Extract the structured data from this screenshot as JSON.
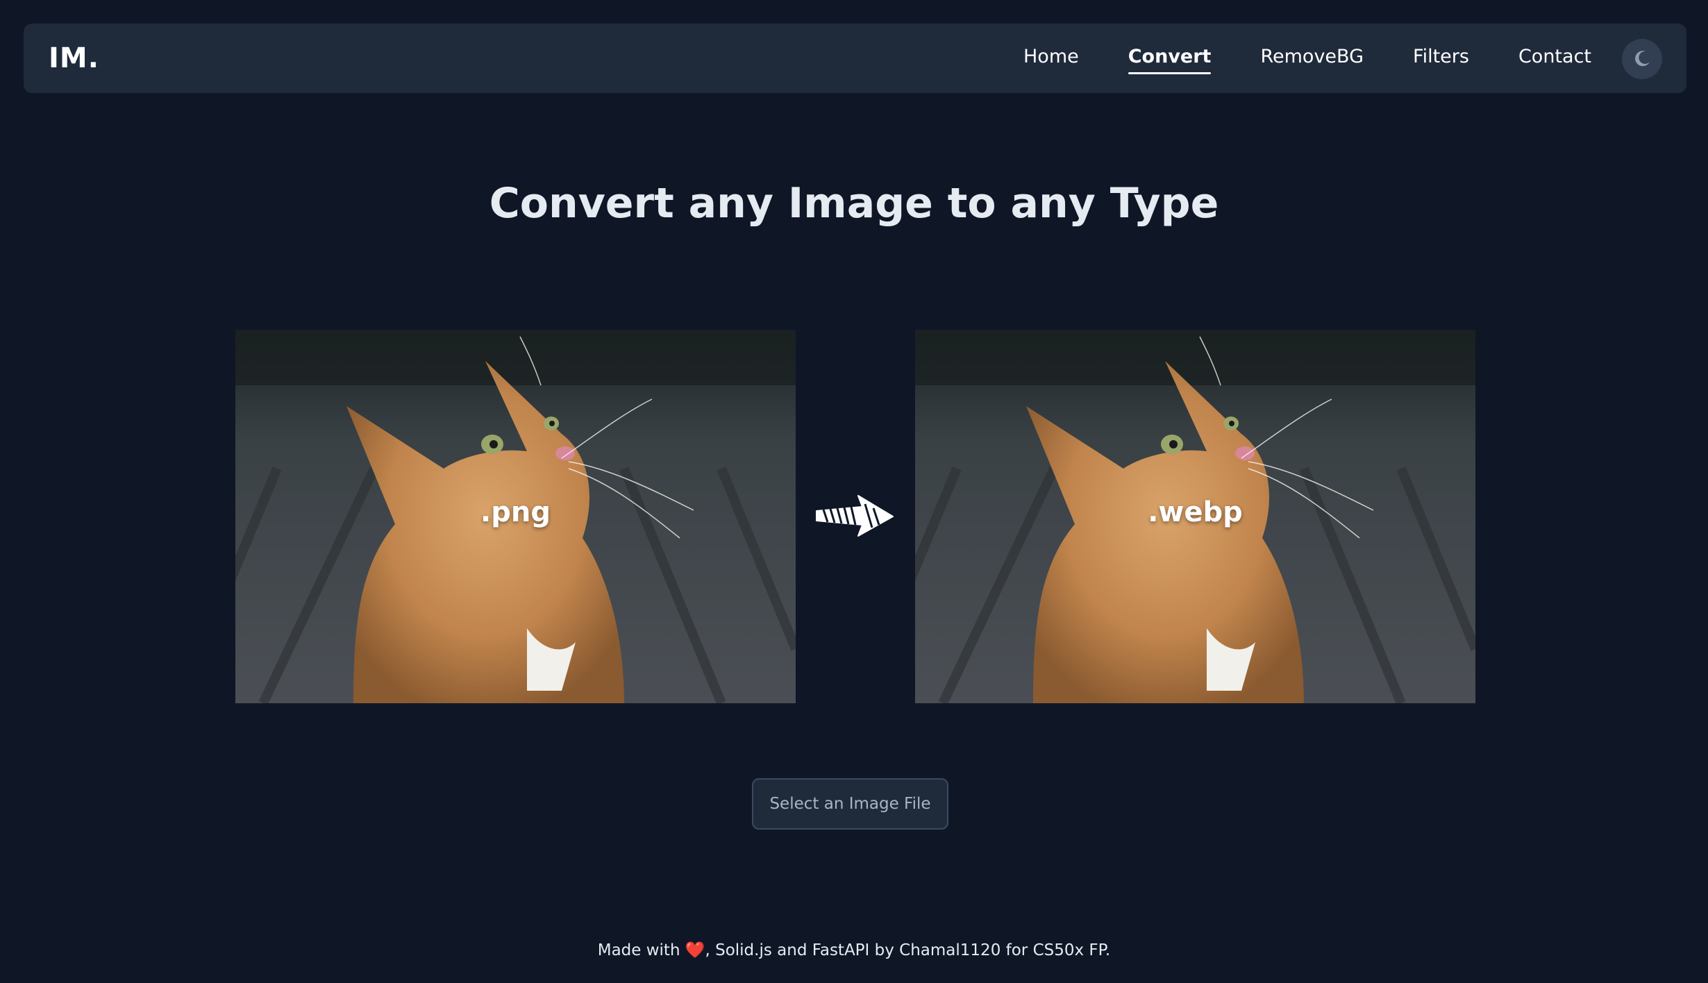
{
  "nav": {
    "logo": "IM.",
    "links": [
      {
        "label": "Home",
        "active": false
      },
      {
        "label": "Convert",
        "active": true
      },
      {
        "label": "RemoveBG",
        "active": false
      },
      {
        "label": "Filters",
        "active": false
      },
      {
        "label": "Contact",
        "active": false
      }
    ],
    "theme_toggle_icon": "moon-icon"
  },
  "main": {
    "heading": "Convert any Image to any Type",
    "source_image": {
      "format_label": ".png",
      "subject": "cat-photo"
    },
    "target_image": {
      "format_label": ".webp",
      "subject": "cat-photo"
    },
    "arrow_icon": "arrow-right-icon",
    "select_button_label": "Select an Image File"
  },
  "footer": {
    "prefix": "Made with",
    "heart_icon": "heart-icon",
    "heart_glyph": "❤️",
    "suffix": ", Solid.js and FastAPI by Chamal1120 for CS50x FP."
  },
  "colors": {
    "background": "#0f1726",
    "navbar": "#1f2a3b",
    "heading": "#e6ebf2",
    "button_text": "#aab4c4",
    "heart": "#e0282e"
  }
}
